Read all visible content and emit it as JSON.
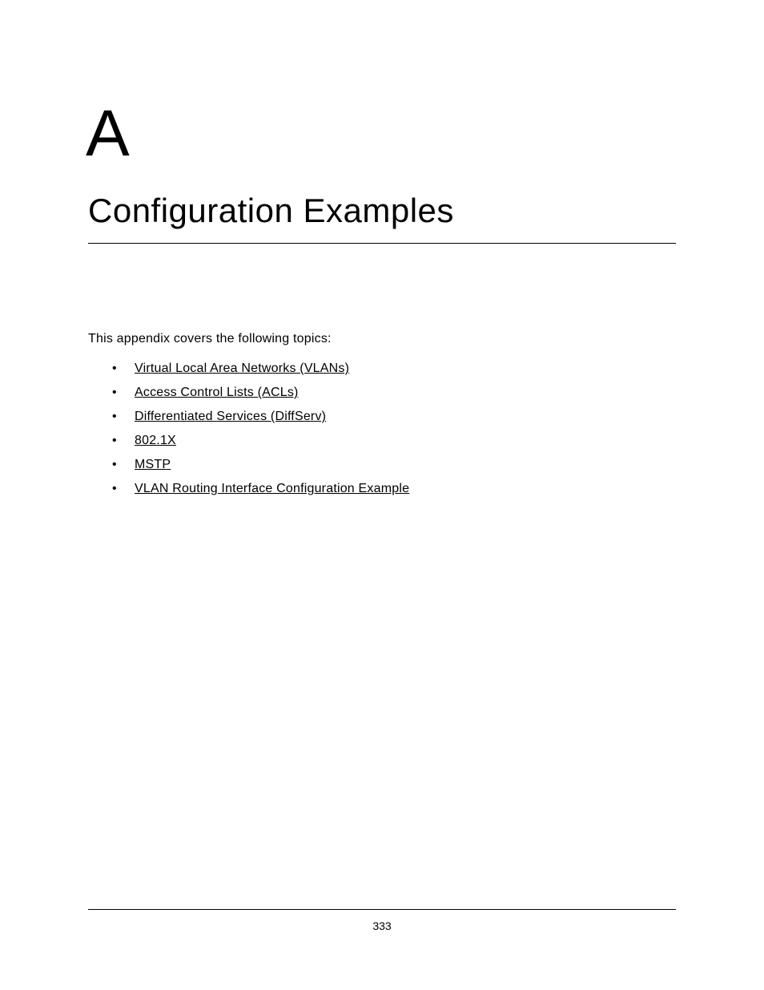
{
  "appendix_letter": "A",
  "title": "Configuration Examples",
  "intro": "This appendix covers the following topics:",
  "topics": [
    "Virtual Local Area Networks (VLANs)",
    "Access Control Lists (ACLs)",
    "Differentiated Services (DiffServ)",
    "802.1X",
    "MSTP",
    "VLAN Routing Interface Configuration Example"
  ],
  "page_number": "333"
}
